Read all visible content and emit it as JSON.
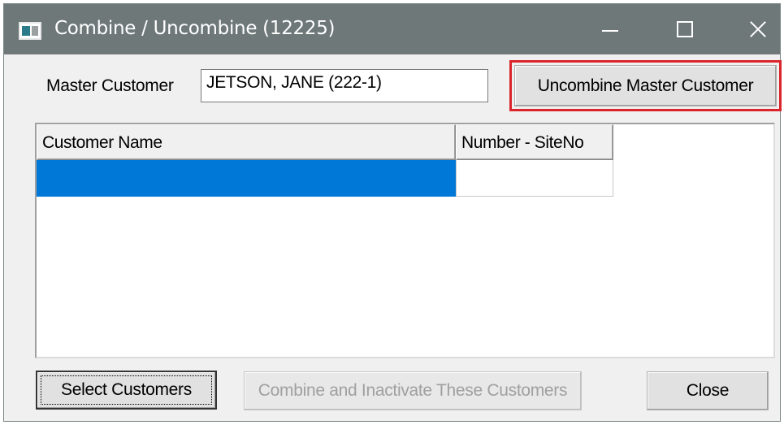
{
  "window": {
    "title": "Combine / Uncombine (12225)",
    "titlebar_color": "#6e7879"
  },
  "titlebar_buttons": {
    "minimize_icon": "minimize-icon",
    "maximize_icon": "maximize-icon",
    "close_icon": "close-icon"
  },
  "master": {
    "label": "Master Customer",
    "value": "JETSON, JANE (222-1)"
  },
  "buttons": {
    "uncombine": "Uncombine Master Customer",
    "select_customers": "Select Customers",
    "combine_inactivate": "Combine and Inactivate These Customers",
    "close": "Close"
  },
  "grid": {
    "columns": [
      "Customer Name",
      "Number - SiteNo"
    ],
    "rows": [
      {
        "name": "",
        "number": "",
        "selected": true
      }
    ],
    "selection_color": "#0078d7"
  },
  "colors": {
    "highlight": "#d9252b"
  }
}
